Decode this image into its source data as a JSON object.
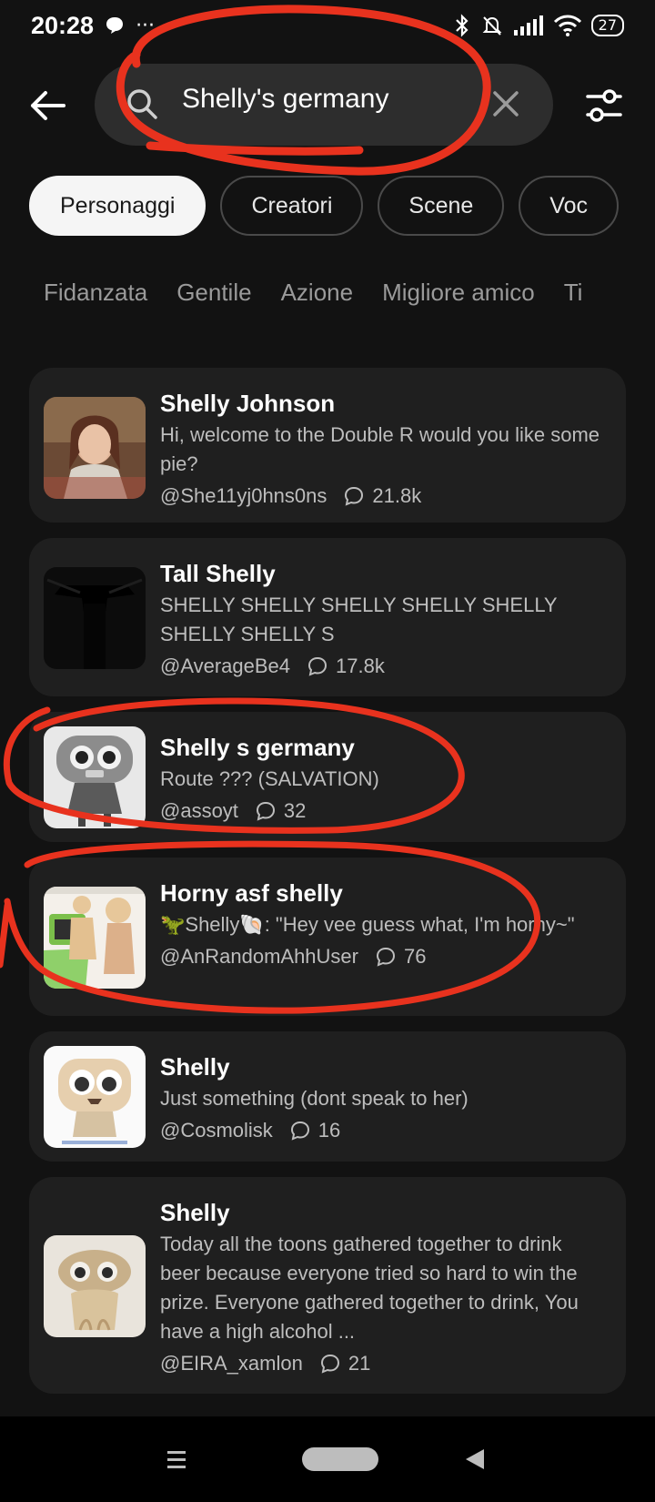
{
  "status_bar": {
    "time": "20:28",
    "battery": "27"
  },
  "search": {
    "query": "Shelly's germany"
  },
  "tabs": [
    {
      "label": "Personaggi",
      "active": true
    },
    {
      "label": "Creatori",
      "active": false
    },
    {
      "label": "Scene",
      "active": false
    },
    {
      "label": "Voc",
      "active": false
    }
  ],
  "categories": [
    "Fidanzata",
    "Gentile",
    "Azione",
    "Migliore amico",
    "Ti"
  ],
  "results": [
    {
      "title": "Shelly Johnson",
      "desc": "Hi,  welcome to the Double R would you like some pie?",
      "author": "@She11yj0hns0ns",
      "chats": "21.8k"
    },
    {
      "title": "Tall Shelly",
      "desc": "SHELLY SHELLY SHELLY SHELLY SHELLY SHELLY SHELLY S",
      "author": "@AverageBe4",
      "chats": "17.8k"
    },
    {
      "title": "Shelly s germany",
      "desc": "Route ??? (SALVATION)",
      "author": "@assoyt",
      "chats": "32"
    },
    {
      "title": "Horny asf shelly",
      "desc": "🦖Shelly🐚: \"Hey vee guess what, I'm horny~\"",
      "author": "@AnRandomAhhUser",
      "chats": "76"
    },
    {
      "title": "Shelly",
      "desc": "Just something (dont speak to her)",
      "author": "@Cosmolisk",
      "chats": "16"
    },
    {
      "title": "Shelly",
      "desc": "Today all the toons gathered together to drink beer because everyone tried so hard to win the prize. Everyone gathered together to drink, You have a high alcohol ...",
      "author": "@EIRA_xamlon",
      "chats": "21"
    }
  ],
  "colors": {
    "annotation": "#e8321e",
    "card": "#1f1f1f",
    "background": "#121212"
  },
  "icons": [
    "back-arrow-icon",
    "search-icon",
    "clear-icon",
    "filter-icon",
    "chat-icon",
    "menu-icon",
    "home-pill-icon",
    "back-triangle-icon"
  ]
}
